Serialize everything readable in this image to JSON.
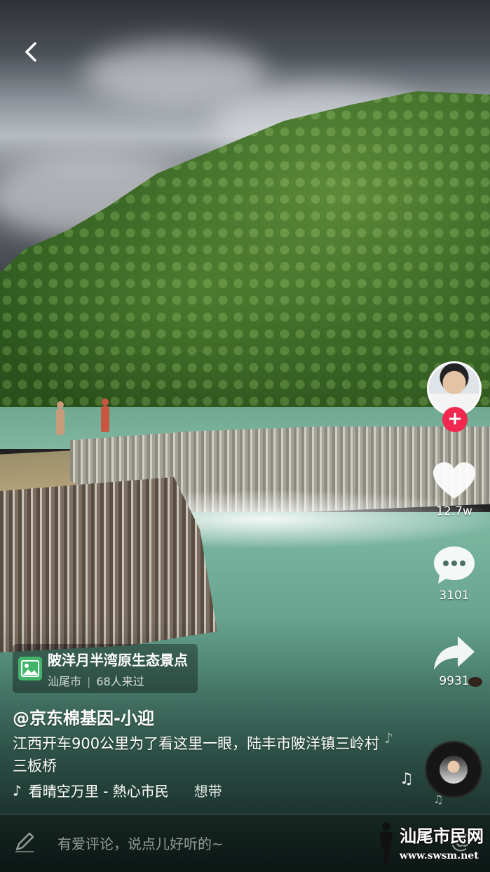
{
  "video": {
    "back_icon": "chevron-left-icon",
    "scene": "waterfall-landscape"
  },
  "rail": {
    "avatar_icon": "user-avatar",
    "follow_label": "+",
    "like_count": "12.7w",
    "comment_count": "3101",
    "share_count": "9931",
    "like_icon": "heart-icon",
    "comment_icon": "speech-bubble-icon",
    "share_icon": "share-arrow-icon",
    "music_icon": "music-disc-icon"
  },
  "poi": {
    "icon": "image-icon",
    "name": "陂洋月半湾原生态景点",
    "city": "汕尾市",
    "visitors": "68人来过"
  },
  "post": {
    "author": "@京东棉基因-小迎",
    "caption": "江西开车900公里为了看这里一眼，陆丰市陂洋镇三岭村三板桥",
    "music_title": "看晴空万里 - 熱心市民",
    "music_more": "想带"
  },
  "comment_bar": {
    "placeholder": "有爱评论，说点儿好听的~",
    "mention_symbol": "@"
  },
  "watermark": {
    "text": "汕尾市民网",
    "url": "www.swsm.net"
  },
  "colors": {
    "follow": "#f0284f",
    "poi_icon": "#43b56a"
  }
}
